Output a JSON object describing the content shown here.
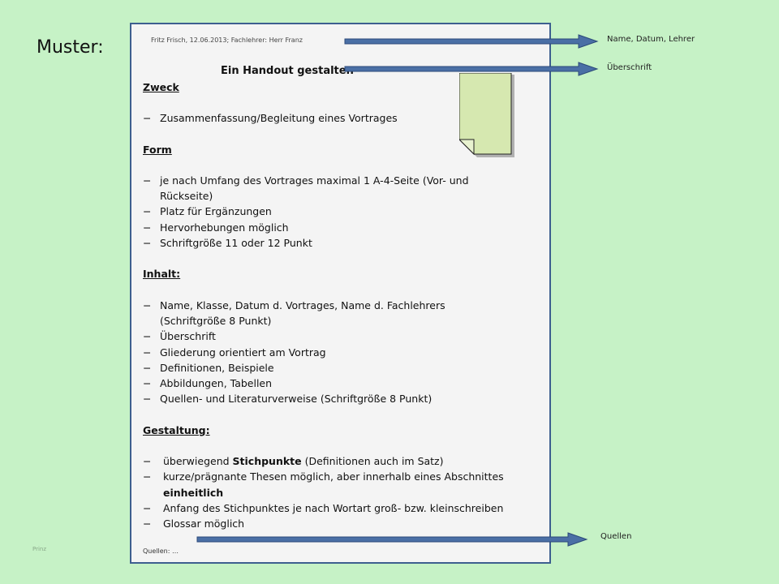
{
  "slide": {
    "label": "Muster:",
    "footer_tiny": "Prinz"
  },
  "handout": {
    "header": "Fritz Frisch, 12.06.2013; Fachlehrer: Herr Franz",
    "title": "Ein Handout gestalten",
    "sections": [
      {
        "heading": "Zweck",
        "items": [
          "Zusammenfassung/Begleitung eines Vortrages"
        ]
      },
      {
        "heading": "Form",
        "items": [
          "je nach Umfang des Vortrages maximal 1 A-4-Seite (Vor- und",
          "Rückseite)",
          "Platz für Ergänzungen",
          "Hervorhebungen möglich",
          "Schriftgröße 11 oder 12 Punkt"
        ]
      },
      {
        "heading": "Inhalt:",
        "items": [
          "Name, Klasse, Datum d. Vortrages, Name d. Fachlehrers",
          "(Schriftgröße 8 Punkt)",
          "Überschrift",
          "Gliederung orientiert am Vortrag",
          "Definitionen, Beispiele",
          "Abbildungen, Tabellen",
          "Quellen- und Literaturverweise (Schriftgröße 8 Punkt)"
        ]
      },
      {
        "heading": "Gestaltung:",
        "items": [
          {
            "bold": "Stichpunkte",
            "pre": "überwiegend ",
            "post": " (Definitionen auch im Satz)"
          },
          "kurze/prägnante Thesen möglich, aber innerhalb eines Abschnittes",
          "einheitlich",
          "Anfang des Stichpunktes je nach Wortart groß- bzw. kleinschreiben",
          "Glossar möglich"
        ]
      }
    ],
    "sources": "Quellen: …"
  },
  "annotations": {
    "name_date_teacher": "Name,  Datum,  Lehrer",
    "heading": "Überschrift",
    "sources": "Quellen"
  },
  "colors": {
    "background": "#c6f2c6",
    "page": "#f4f4f4",
    "page_border": "#3d5f8f",
    "arrow": "#4a6fa5",
    "note": "#d6e8b0"
  }
}
